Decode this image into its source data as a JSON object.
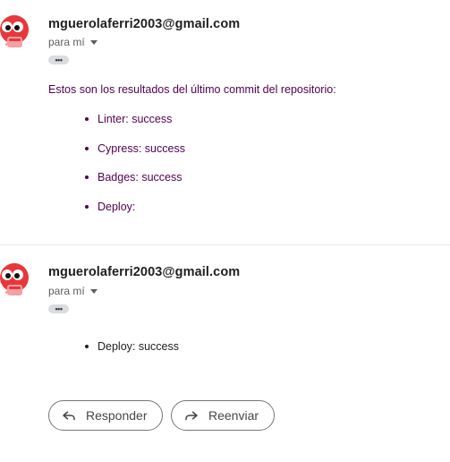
{
  "thread": {
    "messages": [
      {
        "sender": "mguerolaferri2003@gmail.com",
        "recipient_label": "para mí",
        "ellipsis": "•••",
        "intro": "Estos son los resultados del último commit del repositorio:",
        "results": [
          "Linter: success",
          "Cypress: success",
          "Badges: success",
          "Deploy:"
        ]
      },
      {
        "sender": "mguerolaferri2003@gmail.com",
        "recipient_label": "para mí",
        "ellipsis": "•••",
        "results": [
          "Deploy: success"
        ]
      }
    ],
    "actions": {
      "reply_label": "Responder",
      "forward_label": "Reenviar"
    }
  },
  "colors": {
    "avatar_red": "#e8373b",
    "quoted_text": "#500050",
    "button_border": "#747775"
  },
  "icons": [
    "avatar-icon",
    "caret-down-icon",
    "reply-icon",
    "forward-icon"
  ]
}
